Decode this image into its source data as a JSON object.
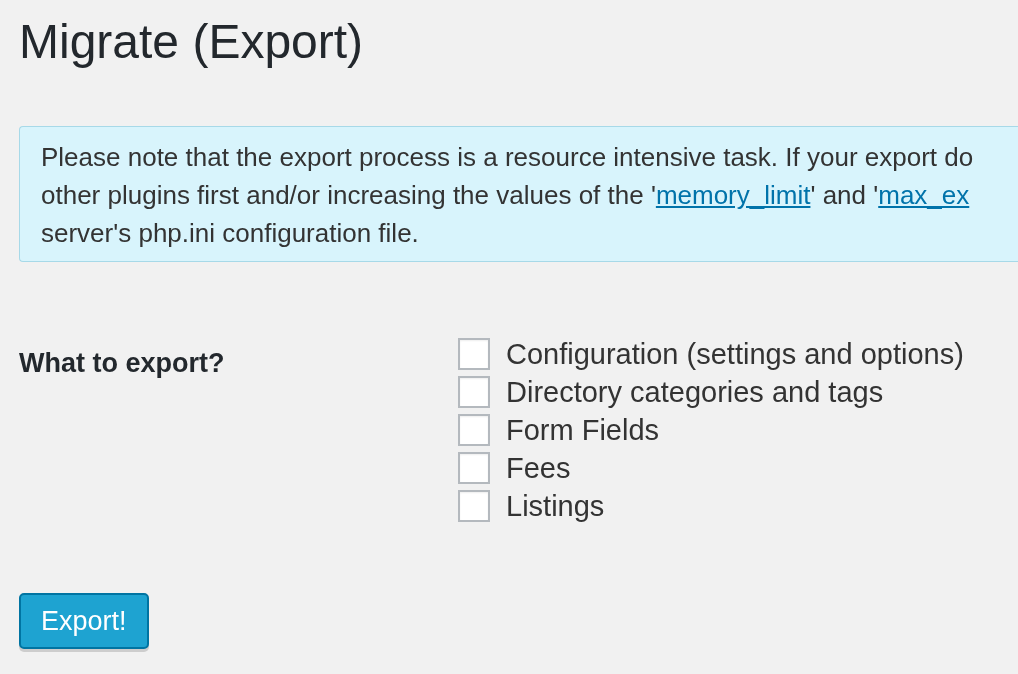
{
  "page": {
    "title": "Migrate (Export)"
  },
  "notice": {
    "lines": [
      {
        "segments": [
          {
            "kind": "text",
            "text": "Please note that the export process is a resource intensive task. If your export do"
          }
        ]
      },
      {
        "segments": [
          {
            "kind": "text",
            "text": "other plugins first and/or increasing the values of the '"
          },
          {
            "kind": "link",
            "text": "memory_limit"
          },
          {
            "kind": "text",
            "text": "' and '"
          },
          {
            "kind": "link",
            "text": "max_ex"
          }
        ]
      },
      {
        "segments": [
          {
            "kind": "text",
            "text": "server's php.ini configuration file."
          }
        ]
      }
    ]
  },
  "export_options": {
    "label": "What to export?",
    "options": [
      {
        "label": "Configuration (settings and options)",
        "checked": false
      },
      {
        "label": "Directory categories and tags",
        "checked": false
      },
      {
        "label": "Form Fields",
        "checked": false
      },
      {
        "label": "Fees",
        "checked": false
      },
      {
        "label": "Listings",
        "checked": false
      }
    ]
  },
  "buttons": [
    {
      "label": "Export!",
      "kind": "primary"
    }
  ]
}
